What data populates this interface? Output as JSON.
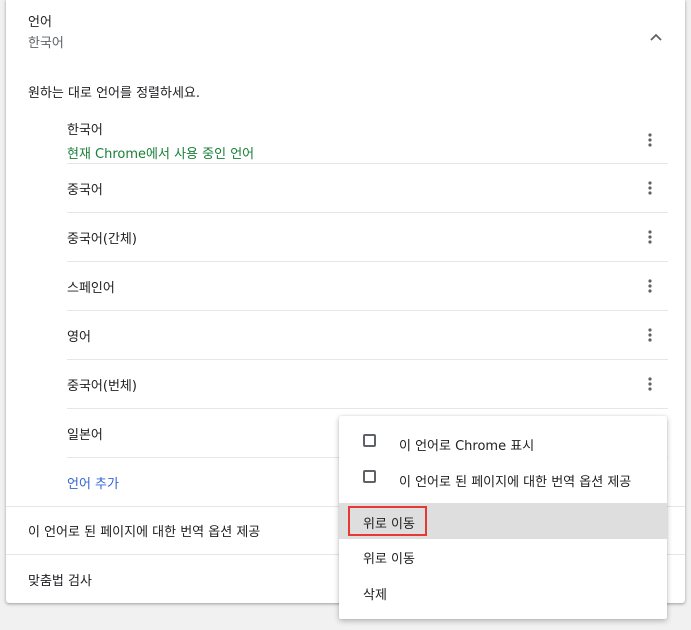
{
  "section": {
    "title": "언어",
    "current": "한국어",
    "instruction": "원하는 대로 언어를 정렬하세요."
  },
  "languages": [
    {
      "name": "한국어",
      "note": "현재 Chrome에서 사용 중인 언어"
    },
    {
      "name": "중국어"
    },
    {
      "name": "중국어(간체)"
    },
    {
      "name": "스페인어"
    },
    {
      "name": "영어"
    },
    {
      "name": "중국어(번체)"
    },
    {
      "name": "일본어"
    }
  ],
  "add_language": "언어 추가",
  "offer_translate": "이 언어로 된 페이지에 대한 번역 옵션 제공",
  "spellcheck": "맞춤법 검사",
  "context_menu": {
    "display_in_chrome": "이 언어로 Chrome 표시",
    "offer_translate": "이 언어로 된 페이지에 대한 번역 옵션 제공",
    "move_to_top": "위로 이동",
    "move_up": "위로 이동",
    "remove": "삭제"
  },
  "icons": {
    "collapse": "chevron-up-icon",
    "row_menu": "more-vert-icon"
  },
  "colors": {
    "note_green": "#188038",
    "link_blue": "#3367d6",
    "highlight_border": "#e53935"
  }
}
